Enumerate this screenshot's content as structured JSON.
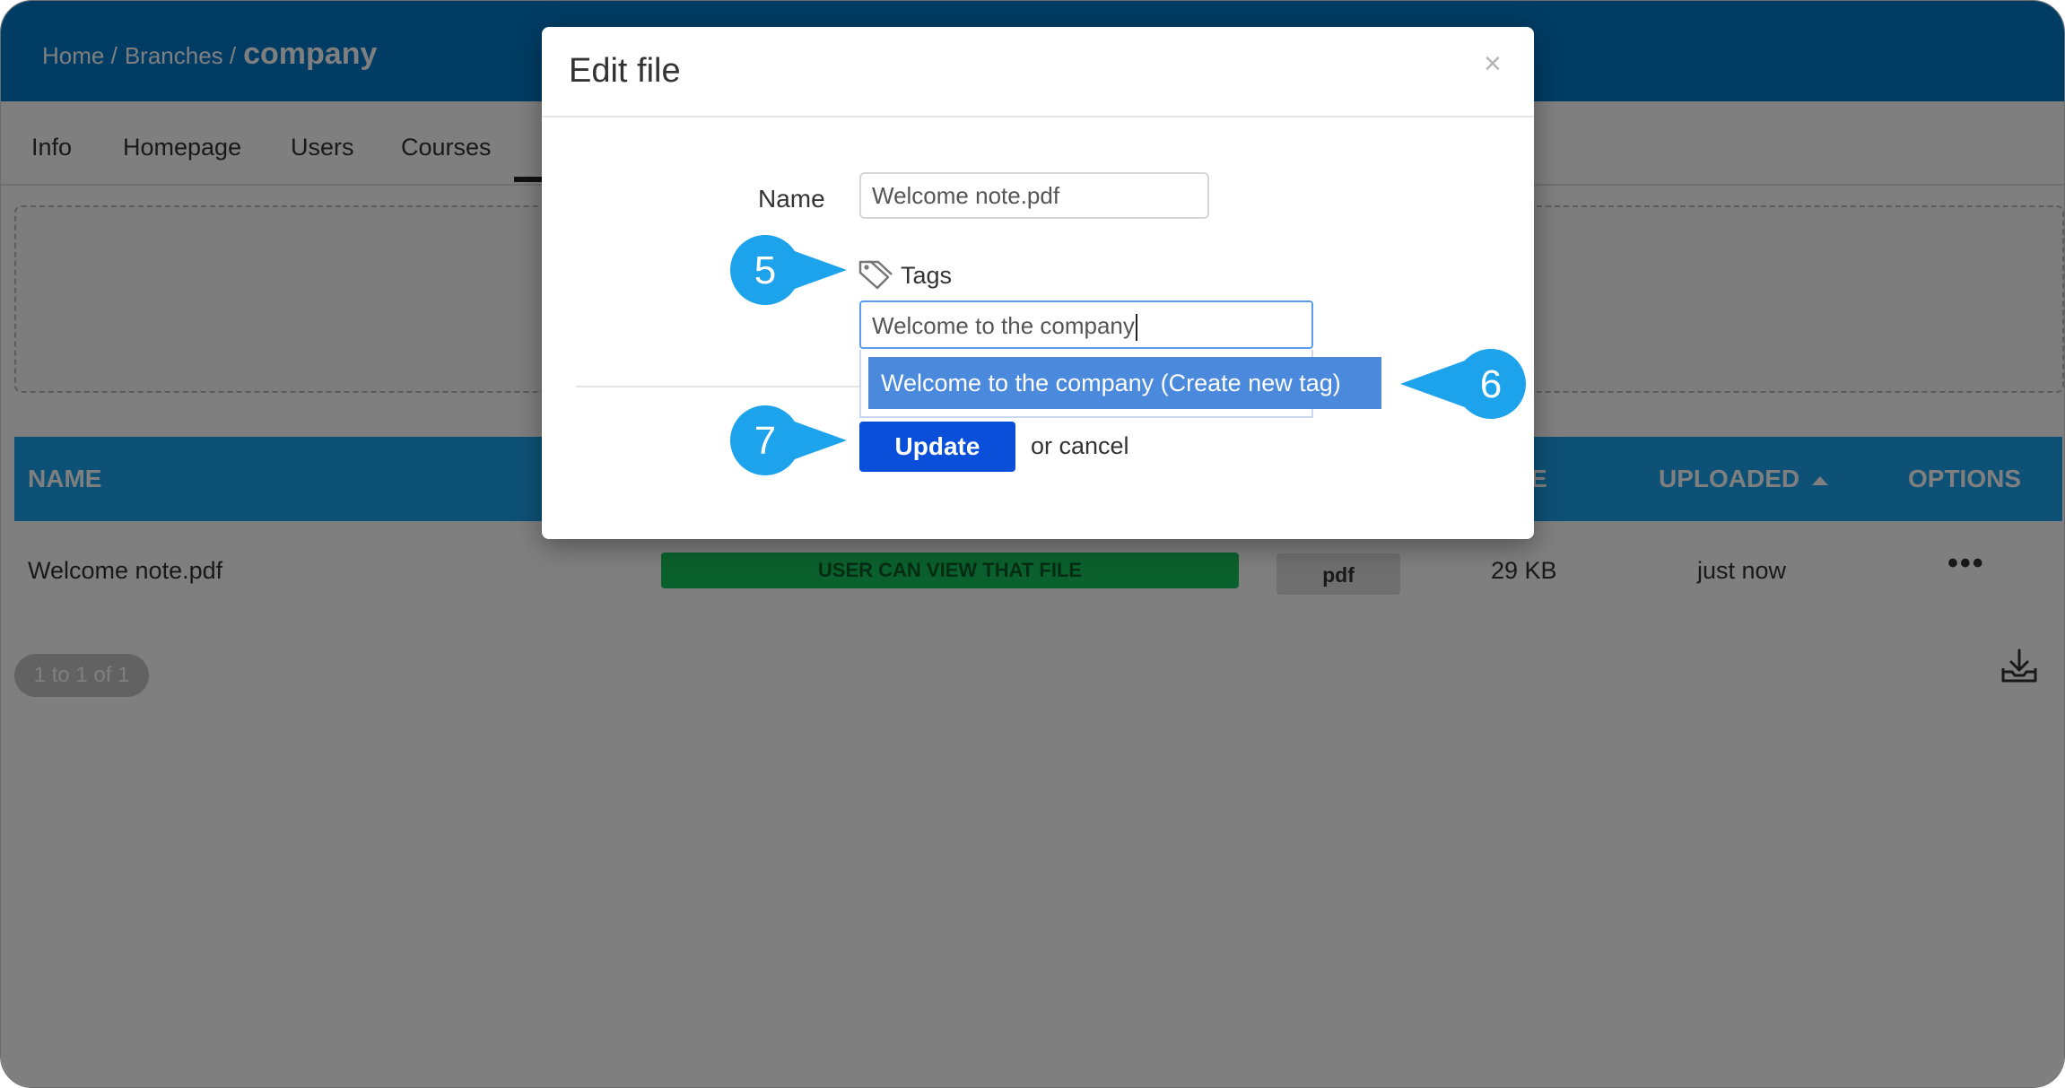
{
  "breadcrumb": {
    "home": "Home /",
    "branches": "Branches /",
    "current": "company"
  },
  "tabs": [
    "Info",
    "Homepage",
    "Users",
    "Courses"
  ],
  "table": {
    "headers": {
      "name": "NAME",
      "size_partial": "E",
      "uploaded": "UPLOADED",
      "options": "OPTIONS"
    },
    "rows": [
      {
        "name": "Welcome note.pdf",
        "permission": "USER CAN VIEW THAT FILE",
        "extension": "pdf",
        "size": "29 KB",
        "uploaded": "just now",
        "options": "•••"
      }
    ],
    "pagination": "1 to 1 of 1"
  },
  "modal": {
    "title": "Edit file",
    "close": "×",
    "name_label": "Name",
    "name_value": "Welcome note.pdf",
    "tags_label": "Tags",
    "tags_value": "Welcome to the company",
    "suggestion": "Welcome to the company (Create new tag)",
    "update_label": "Update",
    "cancel_label": "or cancel"
  },
  "callouts": [
    "5",
    "6",
    "7"
  ],
  "colors": {
    "header": "#0079c9",
    "accent": "#1ca3ec",
    "update_button": "#0a4fd9",
    "permission_badge": "#16c35a",
    "dropdown_highlight": "#4a89dc"
  },
  "icons": [
    "tag-icon",
    "download-icon",
    "sort-ascending-icon",
    "close-icon"
  ]
}
